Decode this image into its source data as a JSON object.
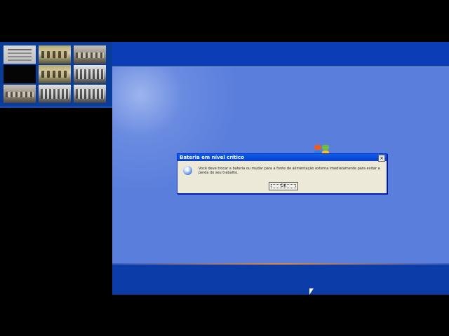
{
  "dialog": {
    "title": "Bateria em nível crítico",
    "message": "Você deve trocar a bateria ou mudar para a fonte de alimentação externa imediatamente para evitar a perda do seu trabalho.",
    "ok_label": "OK",
    "close_glyph": "×",
    "icon": "info-icon"
  },
  "colors": {
    "desktop": "#5a7edc",
    "top_band": "#0b3db6",
    "bottom_band": "#0c3ca8",
    "titlebar": "#0a5ee8",
    "dialog_bg": "#ece9d8"
  },
  "video_feed": {
    "tiles": [
      "slides",
      "people",
      "room",
      "dark",
      "people",
      "cls",
      "room",
      "cls",
      "cls"
    ]
  }
}
